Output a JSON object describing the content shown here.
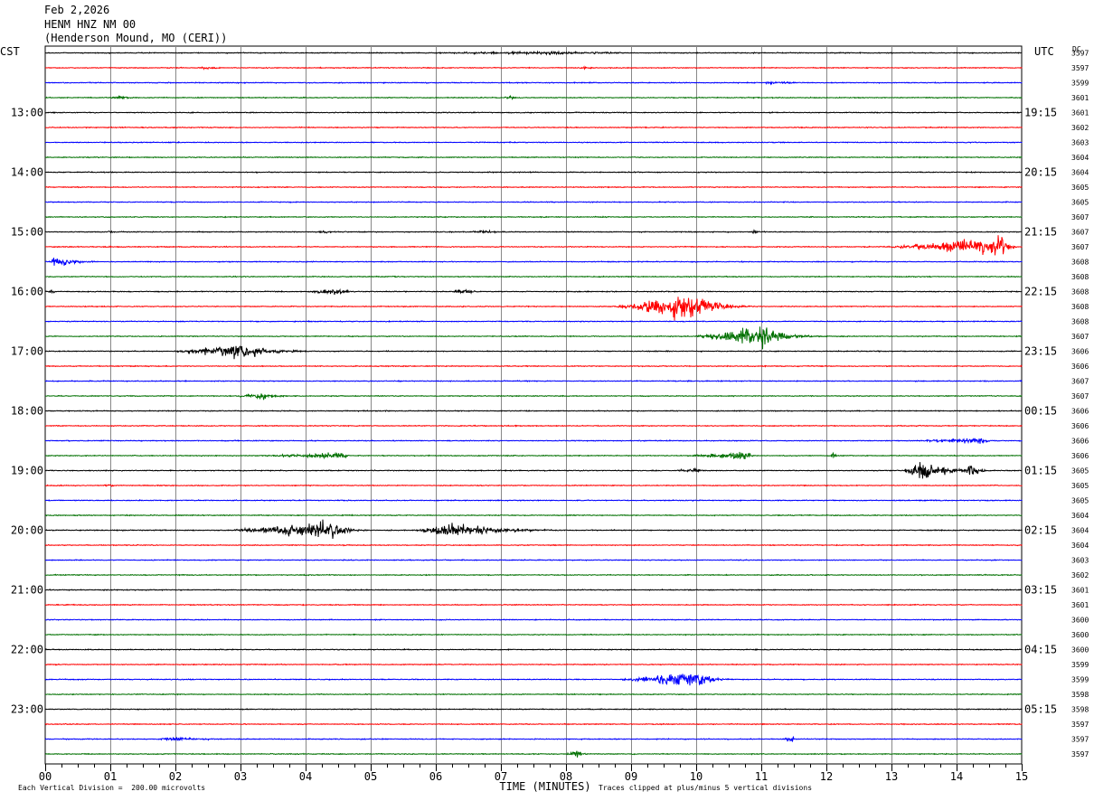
{
  "header": {
    "date": "Feb 2,2026",
    "station": "HENM HNZ NM 00",
    "location": "(Henderson Mound, MO (CERI))"
  },
  "footer": {
    "scale_note": "Each Vertical Division =  200.00 microvolts",
    "clip_note": "Traces clipped at plus/minus 5 vertical divisions"
  },
  "chart_data": {
    "type": "line",
    "title": "",
    "xlabel": "TIME (MINUTES)",
    "left_axis_label": "CST",
    "right_axis_label": "UTC",
    "dc_label": "DC",
    "xlim": [
      0,
      15
    ],
    "x_ticks": [
      "00",
      "01",
      "02",
      "03",
      "04",
      "05",
      "06",
      "07",
      "08",
      "09",
      "10",
      "11",
      "12",
      "13",
      "14",
      "15"
    ],
    "left_hour_labels": [
      "13:00",
      "14:00",
      "15:00",
      "16:00",
      "17:00",
      "18:00",
      "19:00",
      "20:00",
      "21:00",
      "22:00",
      "23:00"
    ],
    "right_hour_labels": [
      "19:15",
      "20:15",
      "21:15",
      "22:15",
      "23:15",
      "00:15",
      "01:15",
      "02:15",
      "03:15",
      "04:15",
      "05:15"
    ],
    "trace_colors": [
      "#000000",
      "#ff0000",
      "#0000ff",
      "#007000"
    ],
    "grid": true,
    "minute_gridlines": true,
    "dc_offsets": [
      "3597",
      "3597",
      "3599",
      "3601",
      "3601",
      "3602",
      "3603",
      "3604",
      "3604",
      "3605",
      "3605",
      "3607",
      "3607",
      "3607",
      "3608",
      "3608",
      "3608",
      "3608",
      "3608",
      "3607",
      "3606",
      "3606",
      "3607",
      "3607",
      "3606",
      "3606",
      "3606",
      "3606",
      "3605",
      "3605",
      "3605",
      "3604",
      "3604",
      "3604",
      "3603",
      "3602",
      "3601",
      "3601",
      "3600",
      "3600",
      "3600",
      "3599",
      "3599",
      "3598",
      "3598",
      "3597",
      "3597",
      "3597"
    ],
    "events": [
      {
        "trace": 0,
        "start": 4.0,
        "end": 10.8,
        "amp": 2,
        "peak": 8
      },
      {
        "trace": 1,
        "start": 2.2,
        "end": 3.0,
        "amp": 2,
        "peak": 2.5
      },
      {
        "trace": 1,
        "start": 8.1,
        "end": 8.6,
        "amp": 2,
        "peak": 8.3
      },
      {
        "trace": 2,
        "start": 10.8,
        "end": 12.2,
        "amp": 2,
        "peak": 11.2
      },
      {
        "trace": 3,
        "start": 0.8,
        "end": 1.6,
        "amp": 2,
        "peak": 1.2
      },
      {
        "trace": 3,
        "start": 7.0,
        "end": 7.3,
        "amp": 4,
        "peak": 7.15
      },
      {
        "trace": 12,
        "start": 0.9,
        "end": 1.2,
        "amp": 2,
        "peak": 1.0
      },
      {
        "trace": 12,
        "start": 4.0,
        "end": 4.6,
        "amp": 2,
        "peak": 4.3
      },
      {
        "trace": 12,
        "start": 6.3,
        "end": 7.4,
        "amp": 2,
        "peak": 6.8
      },
      {
        "trace": 12,
        "start": 10.8,
        "end": 11.0,
        "amp": 3,
        "peak": 10.9
      },
      {
        "trace": 13,
        "start": 12.5,
        "end": 15.0,
        "amp": 13,
        "peak": 14.7
      },
      {
        "trace": 14,
        "start": 0.05,
        "end": 1.0,
        "amp": 7,
        "peak": 0.15
      },
      {
        "trace": 16,
        "start": 0.0,
        "end": 0.3,
        "amp": 3,
        "peak": 0.1
      },
      {
        "trace": 16,
        "start": 3.8,
        "end": 5.0,
        "amp": 4,
        "peak": 4.5
      },
      {
        "trace": 16,
        "start": 6.2,
        "end": 6.9,
        "amp": 4,
        "peak": 6.4
      },
      {
        "trace": 17,
        "start": 8.6,
        "end": 10.9,
        "amp": 20,
        "peak": 9.85
      },
      {
        "trace": 19,
        "start": 9.8,
        "end": 12.0,
        "amp": 16,
        "peak": 11.0
      },
      {
        "trace": 20,
        "start": 1.8,
        "end": 4.2,
        "amp": 11,
        "peak": 3.0
      },
      {
        "trace": 23,
        "start": 2.8,
        "end": 3.9,
        "amp": 5,
        "peak": 3.35
      },
      {
        "trace": 26,
        "start": 13.0,
        "end": 14.6,
        "amp": 4,
        "peak": 14.4
      },
      {
        "trace": 27,
        "start": 2.8,
        "end": 4.8,
        "amp": 4,
        "peak": 4.6
      },
      {
        "trace": 27,
        "start": 9.6,
        "end": 10.9,
        "amp": 6,
        "peak": 10.8
      },
      {
        "trace": 27,
        "start": 12.05,
        "end": 12.2,
        "amp": 6,
        "peak": 12.1
      },
      {
        "trace": 28,
        "start": 9.5,
        "end": 10.3,
        "amp": 3,
        "peak": 10.0
      },
      {
        "trace": 28,
        "start": 13.1,
        "end": 14.6,
        "amp": 13,
        "peak": 13.45
      },
      {
        "trace": 28,
        "start": 14.0,
        "end": 14.6,
        "amp": 9,
        "peak": 14.2
      },
      {
        "trace": 29,
        "start": 0.8,
        "end": 1.2,
        "amp": 2,
        "peak": 1.0
      },
      {
        "trace": 32,
        "start": 2.5,
        "end": 5.0,
        "amp": 12,
        "peak": 4.4
      },
      {
        "trace": 32,
        "start": 5.6,
        "end": 8.2,
        "amp": 10,
        "peak": 6.2
      },
      {
        "trace": 42,
        "start": 8.6,
        "end": 10.6,
        "amp": 11,
        "peak": 10.0
      },
      {
        "trace": 46,
        "start": 1.7,
        "end": 3.6,
        "amp": 3,
        "peak": 1.85
      },
      {
        "trace": 46,
        "start": 11.3,
        "end": 11.6,
        "amp": 5,
        "peak": 11.45
      },
      {
        "trace": 47,
        "start": 7.95,
        "end": 8.4,
        "amp": 6,
        "peak": 8.15
      }
    ]
  }
}
